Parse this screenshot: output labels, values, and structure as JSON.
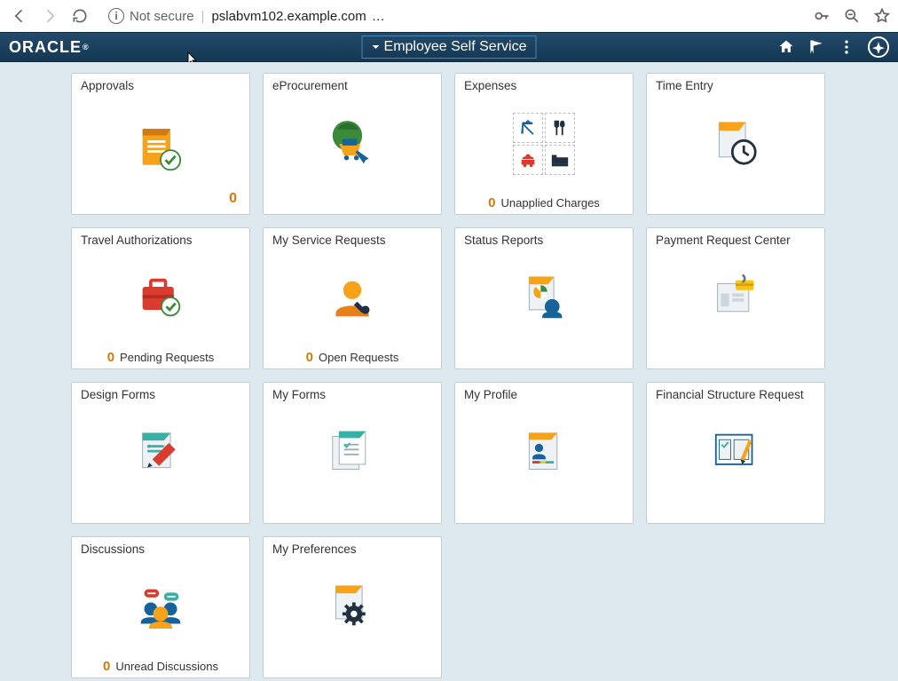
{
  "browser": {
    "security_label": "Not secure",
    "host": "pslabvm102.example.com",
    "ellipsis": "…"
  },
  "header": {
    "brand": "ORACLE",
    "homepage_label": "Employee Self Service"
  },
  "tiles": {
    "approvals": {
      "title": "Approvals",
      "count": "0"
    },
    "eprocurement": {
      "title": "eProcurement"
    },
    "expenses": {
      "title": "Expenses",
      "count": "0",
      "sub": "Unapplied Charges"
    },
    "time_entry": {
      "title": "Time Entry"
    },
    "travel_auth": {
      "title": "Travel Authorizations",
      "count": "0",
      "sub": "Pending Requests"
    },
    "service_req": {
      "title": "My Service Requests",
      "count": "0",
      "sub": "Open Requests"
    },
    "status_reports": {
      "title": "Status Reports"
    },
    "payment_request": {
      "title": "Payment Request Center"
    },
    "design_forms": {
      "title": "Design Forms"
    },
    "my_forms": {
      "title": "My Forms"
    },
    "my_profile": {
      "title": "My Profile"
    },
    "fin_struct": {
      "title": "Financial Structure Request"
    },
    "discussions": {
      "title": "Discussions",
      "count": "0",
      "sub": "Unread Discussions"
    },
    "my_prefs": {
      "title": "My Preferences"
    }
  }
}
